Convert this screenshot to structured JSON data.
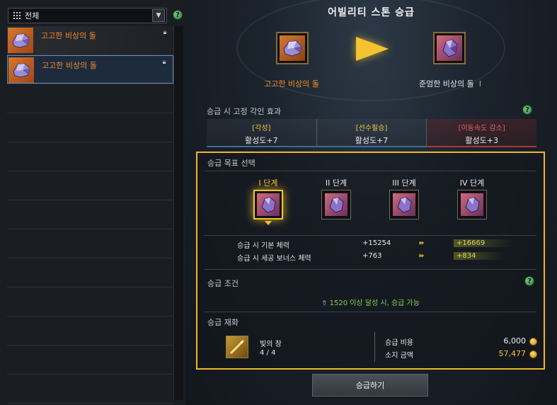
{
  "left_panel": {
    "filter": {
      "label": "전체",
      "dropdown_icon": "chevron-down-icon"
    },
    "help_icon_label": "?",
    "items": [
      {
        "name": "고고한 비상의 돌",
        "lock_icon": "lock-icon",
        "selected": false
      },
      {
        "name": "고고한 비상의 돌",
        "lock_icon": "lock-icon",
        "selected": true
      }
    ]
  },
  "title": "어빌리티 스톤 승급",
  "stones": {
    "current": {
      "name": "고고한 비상의 돌",
      "color": "#f08a2a"
    },
    "next": {
      "name": "준엄한 비상의 돌",
      "suffix": "I",
      "color": "#e6e8ec"
    }
  },
  "engrave": {
    "label": "승급 시 고정 각인 효과",
    "help": "?",
    "cells": [
      {
        "name": "[각성]",
        "value": "활성도+7"
      },
      {
        "name": "[선수필승]",
        "value": "활성도+7"
      },
      {
        "name": "[이동속도 감소]",
        "value": "활성도+3"
      }
    ]
  },
  "target": {
    "label": "승급 목표 선택",
    "stages": [
      {
        "label": "I 단계",
        "active": true
      },
      {
        "label": "II 단계",
        "active": false
      },
      {
        "label": "III 단계",
        "active": false
      },
      {
        "label": "IV 단계",
        "active": false
      }
    ],
    "stats": [
      {
        "label": "승급 시 기본 체력",
        "current": "+15254",
        "arrow": "›››",
        "next": "+16669"
      },
      {
        "label": "승급 시 세공 보너스 체력",
        "current": "+763",
        "arrow": "›››",
        "next": "+834"
      }
    ],
    "condition": {
      "label": "승급 조건",
      "help": "?",
      "text": "1520 이상 달성 시, 승급 가능"
    },
    "materials": {
      "label": "승급 재화",
      "item_name": "빛의 창",
      "item_count": "4 / 4",
      "cost_label": "승급 비용",
      "cost_value": "6,000",
      "owned_label": "소지 금액",
      "owned_value": "57,477"
    }
  },
  "upgrade_button": "승급하기",
  "colors": {
    "accent": "#f5c331",
    "orange_text": "#f08a2a",
    "green_text": "#7ed34d",
    "negative": "#e26060"
  }
}
